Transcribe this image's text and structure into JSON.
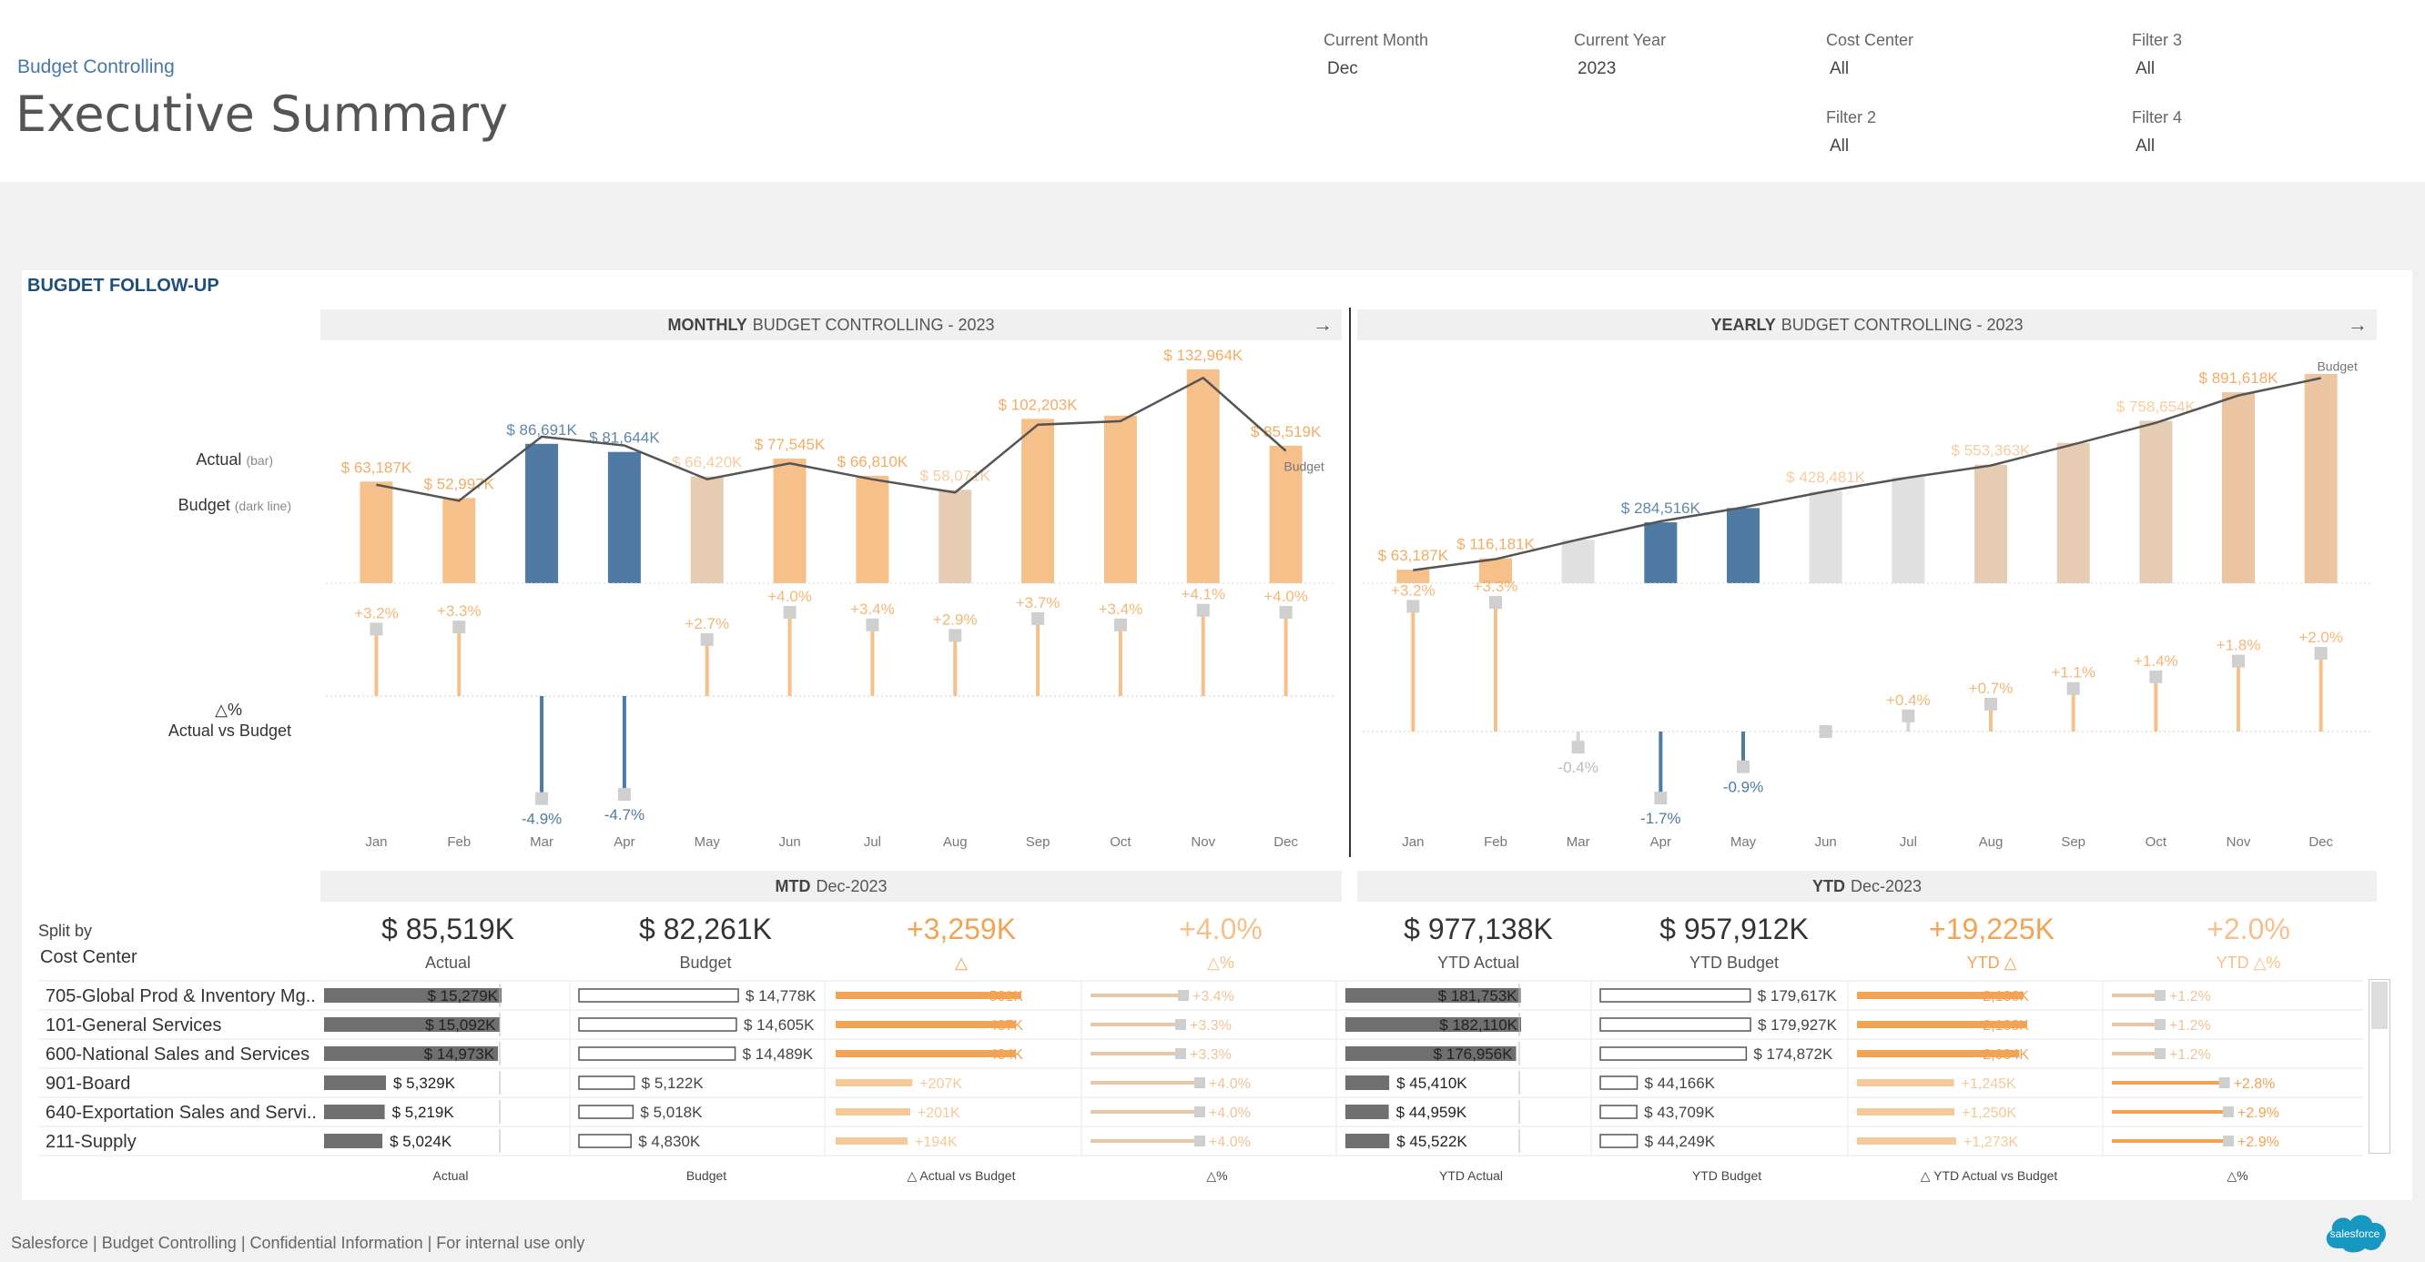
{
  "header": {
    "breadcrumb": "Budget Controlling",
    "title": "Executive Summary",
    "filters": [
      {
        "label": "Current Month",
        "value": "Dec"
      },
      {
        "label": "Current Year",
        "value": "2023"
      },
      {
        "label": "Cost Center",
        "value": "All"
      },
      {
        "label": "Filter 3",
        "value": "All"
      },
      {
        "label": "Filter 2",
        "value": "All"
      },
      {
        "label": "Filter 4",
        "value": "All"
      }
    ]
  },
  "section_title": "BUGDET FOLLOW-UP",
  "side_labels": {
    "actual": "Actual",
    "actual_note": "(bar)",
    "budget": "Budget",
    "budget_note": "(dark line)",
    "delta_1": "△%",
    "delta_2": "Actual vs Budget"
  },
  "chart_data": [
    {
      "type": "bar",
      "title_bold": "MONTHLY",
      "title": "BUDGET CONTROLLING - 2023",
      "categories": [
        "Jan",
        "Feb",
        "Mar",
        "Apr",
        "May",
        "Jun",
        "Jul",
        "Aug",
        "Sep",
        "Oct",
        "Nov",
        "Dec"
      ],
      "series": [
        {
          "name": "Actual",
          "values": [
            63187,
            52997,
            86691,
            81644,
            66420,
            77545,
            66810,
            58071,
            102203,
            104200,
            132964,
            85519
          ]
        },
        {
          "name": "Budget",
          "values": [
            61226,
            51300,
            91173,
            85676,
            64673,
            74563,
            64613,
            56434,
            98556,
            100774,
            127727,
            82261
          ]
        }
      ],
      "bar_labels": [
        "$ 63,187K",
        "$ 52,997K",
        "$ 86,691K",
        "$ 81,644K",
        "$ 66,420K",
        "$ 77,545K",
        "$ 66,810K",
        "$ 58,071K",
        "$ 102,203K",
        "",
        "$ 132,964K",
        "$ 85,519K"
      ],
      "delta_pct": [
        3.2,
        3.3,
        -4.9,
        -4.7,
        2.7,
        4.0,
        3.4,
        2.9,
        3.7,
        3.4,
        4.1,
        4.0
      ],
      "delta_labels": [
        "+3.2%",
        "+3.3%",
        "-4.9%",
        "-4.7%",
        "+2.7%",
        "+4.0%",
        "+3.4%",
        "+2.9%",
        "+3.7%",
        "+3.4%",
        "+4.1%",
        "+4.0%"
      ],
      "end_label": "Budget",
      "colors": [
        "#f6c08a",
        "#f6c08a",
        "#4e7aa3",
        "#4e7aa3",
        "#e5ccb3",
        "#f6c08a",
        "#f6c08a",
        "#e5ccb3",
        "#f6c08a",
        "#f6c08a",
        "#f6c08a",
        "#f6c08a"
      ]
    },
    {
      "type": "bar",
      "title_bold": "YEARLY",
      "title": "BUDGET CONTROLLING - 2023",
      "categories": [
        "Jan",
        "Feb",
        "Mar",
        "Apr",
        "May",
        "Jun",
        "Jul",
        "Aug",
        "Sep",
        "Oct",
        "Nov",
        "Dec"
      ],
      "series": [
        {
          "name": "Actual",
          "values": [
            63187,
            116181,
            202872,
            284516,
            350936,
            428481,
            495291,
            553363,
            655566,
            758654,
            891618,
            977138
          ]
        },
        {
          "name": "Budget",
          "values": [
            61226,
            112526,
            203699,
            289375,
            354048,
            428611,
            493224,
            549658,
            648214,
            748988,
            876715,
            957912
          ]
        }
      ],
      "bar_labels": [
        "$ 63,187K",
        "$ 116,181K",
        "",
        "$ 284,516K",
        "",
        "$ 428,481K",
        "",
        "$ 553,363K",
        "",
        "$ 758,654K",
        "$ 891,618K",
        ""
      ],
      "delta_pct": [
        3.2,
        3.3,
        -0.4,
        -1.7,
        -0.9,
        0.0,
        0.4,
        0.7,
        1.1,
        1.4,
        1.8,
        2.0
      ],
      "delta_labels": [
        "+3.2%",
        "+3.3%",
        "-0.4%",
        "-1.7%",
        "-0.9%",
        "",
        "+0.4%",
        "+0.7%",
        "+1.1%",
        "+1.4%",
        "+1.8%",
        "+2.0%"
      ],
      "end_label": "Budget",
      "colors": [
        "#f6c08a",
        "#f6c08a",
        "#e0e0e0",
        "#4e7aa3",
        "#4e7aa3",
        "#e0e0e0",
        "#e0e0e0",
        "#e5ccb3",
        "#e5ccb3",
        "#e5ccb3",
        "#ecc5a2",
        "#ecc5a2"
      ]
    }
  ],
  "mtd": {
    "header_bold": "MTD",
    "header": "Dec-2023",
    "kpis": [
      {
        "value": "$ 85,519K",
        "label": "Actual"
      },
      {
        "value": "$ 82,261K",
        "label": "Budget"
      },
      {
        "value": "+3,259K",
        "label": "△"
      },
      {
        "value": "+4.0%",
        "label": "△%"
      }
    ]
  },
  "ytd": {
    "header_bold": "YTD",
    "header": "Dec-2023",
    "kpis": [
      {
        "value": "$ 977,138K",
        "label": "YTD Actual"
      },
      {
        "value": "$ 957,912K",
        "label": "YTD Budget"
      },
      {
        "value": "+19,225K",
        "label": "YTD △"
      },
      {
        "value": "+2.0%",
        "label": "YTD △%"
      }
    ]
  },
  "split": {
    "label_1": "Split by",
    "label_2": "Cost Center"
  },
  "table": {
    "rows": [
      {
        "name": "705-Global Prod & Inventory Mg..",
        "actual": "$ 15,279K",
        "actual_v": 15279,
        "budget": "$ 14,778K",
        "budget_v": 14778,
        "delta": "+501K",
        "delta_v": 501,
        "pct": "+3.4%",
        "pct_v": 3.4,
        "ytd_actual": "$ 181,753K",
        "ytd_actual_v": 181753,
        "ytd_budget": "$ 179,617K",
        "ytd_budget_v": 179617,
        "ytd_delta": "+2,136K",
        "ytd_delta_v": 2136,
        "ytd_pct": "+1.2%",
        "ytd_pct_v": 1.2
      },
      {
        "name": "101-General Services",
        "actual": "$ 15,092K",
        "actual_v": 15092,
        "budget": "$ 14,605K",
        "budget_v": 14605,
        "delta": "+487K",
        "delta_v": 487,
        "pct": "+3.3%",
        "pct_v": 3.3,
        "ytd_actual": "$ 182,110K",
        "ytd_actual_v": 182110,
        "ytd_budget": "$ 179,927K",
        "ytd_budget_v": 179927,
        "ytd_delta": "+2,183K",
        "ytd_delta_v": 2183,
        "ytd_pct": "+1.2%",
        "ytd_pct_v": 1.2
      },
      {
        "name": "600-National Sales and Services",
        "actual": "$ 14,973K",
        "actual_v": 14973,
        "budget": "$ 14,489K",
        "budget_v": 14489,
        "delta": "+484K",
        "delta_v": 484,
        "pct": "+3.3%",
        "pct_v": 3.3,
        "ytd_actual": "$ 176,956K",
        "ytd_actual_v": 176956,
        "ytd_budget": "$ 174,872K",
        "ytd_budget_v": 174872,
        "ytd_delta": "+2,084K",
        "ytd_delta_v": 2084,
        "ytd_pct": "+1.2%",
        "ytd_pct_v": 1.2
      },
      {
        "name": "901-Board",
        "actual": "$ 5,329K",
        "actual_v": 5329,
        "budget": "$ 5,122K",
        "budget_v": 5122,
        "delta": "+207K",
        "delta_v": 207,
        "pct": "+4.0%",
        "pct_v": 4.0,
        "ytd_actual": "$ 45,410K",
        "ytd_actual_v": 45410,
        "ytd_budget": "$ 44,166K",
        "ytd_budget_v": 44166,
        "ytd_delta": "+1,245K",
        "ytd_delta_v": 1245,
        "ytd_pct": "+2.8%",
        "ytd_pct_v": 2.8
      },
      {
        "name": "640-Exportation Sales and Servi..",
        "actual": "$ 5,219K",
        "actual_v": 5219,
        "budget": "$ 5,018K",
        "budget_v": 5018,
        "delta": "+201K",
        "delta_v": 201,
        "pct": "+4.0%",
        "pct_v": 4.0,
        "ytd_actual": "$ 44,959K",
        "ytd_actual_v": 44959,
        "ytd_budget": "$ 43,709K",
        "ytd_budget_v": 43709,
        "ytd_delta": "+1,250K",
        "ytd_delta_v": 1250,
        "ytd_pct": "+2.9%",
        "ytd_pct_v": 2.9
      },
      {
        "name": "211-Supply",
        "actual": "$ 5,024K",
        "actual_v": 5024,
        "budget": "$ 4,830K",
        "budget_v": 4830,
        "delta": "+194K",
        "delta_v": 194,
        "pct": "+4.0%",
        "pct_v": 4.0,
        "ytd_actual": "$ 45,522K",
        "ytd_actual_v": 45522,
        "ytd_budget": "$ 44,249K",
        "ytd_budget_v": 44249,
        "ytd_delta": "+1,273K",
        "ytd_delta_v": 1273,
        "ytd_pct": "+2.9%",
        "ytd_pct_v": 2.9
      }
    ],
    "footers": [
      "Actual",
      "Budget",
      "△ Actual vs Budget",
      "△%",
      "YTD Actual",
      "YTD Budget",
      "△ YTD Actual vs Budget",
      "△%"
    ]
  },
  "footer": "Salesforce | Budget Controlling | Confidential Information | For internal use only",
  "logo_text": "salesforce",
  "colors": {
    "orange": "#f2a454",
    "peach": "#f6c08a",
    "blue": "#4e7aa3",
    "dark": "#555555",
    "bar_dark": "#707070"
  }
}
